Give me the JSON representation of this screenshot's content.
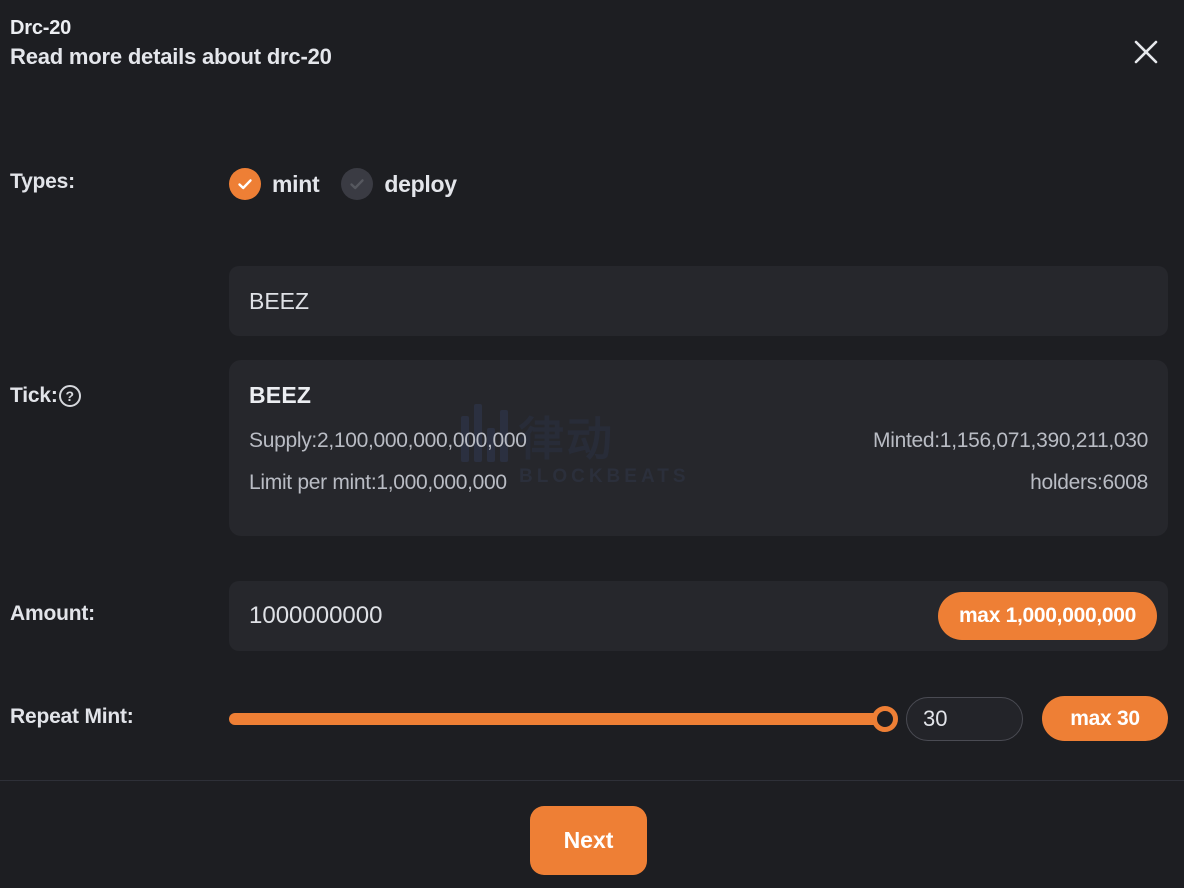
{
  "header": {
    "title": "Drc-20",
    "subtitle": "Read more details about drc-20",
    "close_label": "×"
  },
  "types": {
    "label": "Types:",
    "options": [
      {
        "label": "mint",
        "selected": true
      },
      {
        "label": "deploy",
        "selected": false
      }
    ]
  },
  "tick": {
    "label": "Tick:",
    "help_icon": "?",
    "input_value": "BEEZ",
    "input_placeholder": "",
    "card": {
      "name": "BEEZ",
      "supply": "Supply:2,100,000,000,000,000",
      "minted": "Minted:1,156,071,390,211,030",
      "limit_per_mint": "Limit per mint:1,000,000,000",
      "holders": "holders:6008"
    }
  },
  "watermark": {
    "cn": "律动",
    "en": "BLOCKBEATS"
  },
  "amount": {
    "label": "Amount:",
    "value": "1000000000",
    "placeholder": "",
    "max_button": "max 1,000,000,000"
  },
  "repeat_mint": {
    "label": "Repeat Mint:",
    "value": "30",
    "max_button": "max 30",
    "slider_percent": 100,
    "slider_min": 1,
    "slider_max": 30
  },
  "footer": {
    "next_label": "Next"
  },
  "colors": {
    "accent": "#ee7f35",
    "background": "#1d1e22",
    "field": "#26272c",
    "text": "#e2e4e9",
    "muted_text": "#b9bcc4"
  }
}
